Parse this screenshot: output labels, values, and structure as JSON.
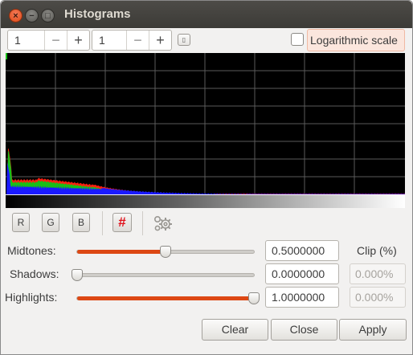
{
  "window": {
    "title": "Histograms",
    "close_glyph": "×",
    "minimize_glyph": "−",
    "maximize_glyph": "□"
  },
  "toolbar": {
    "spin1": {
      "value": "1",
      "minus": "−",
      "plus": "+"
    },
    "spin2": {
      "value": "1",
      "minus": "−",
      "plus": "+"
    },
    "log_scale": {
      "label": "Logarithmic scale",
      "checked": false
    }
  },
  "channels": {
    "r": "R",
    "g": "G",
    "b": "B",
    "grid_glyph": "#",
    "settings_icon": "gears-icon"
  },
  "colors": {
    "accent": "#dd4814",
    "hist_red": "#ff2010",
    "hist_green": "#18c018",
    "hist_blue": "#1a1aff",
    "grid_active": "#e0111b"
  },
  "levels": {
    "midtones": {
      "label": "Midtones:",
      "value": "0.5000000",
      "level": 0.5
    },
    "shadows": {
      "label": "Shadows:",
      "value": "0.0000000",
      "level": 0.0
    },
    "highlights": {
      "label": "Highlights:",
      "value": "1.0000000",
      "level": 1.0
    }
  },
  "clip": {
    "label": "Clip (%)",
    "shadows": "0.000%",
    "highlights": "0.000%"
  },
  "buttons": {
    "clear": "Clear",
    "close": "Close",
    "apply": "Apply"
  }
}
